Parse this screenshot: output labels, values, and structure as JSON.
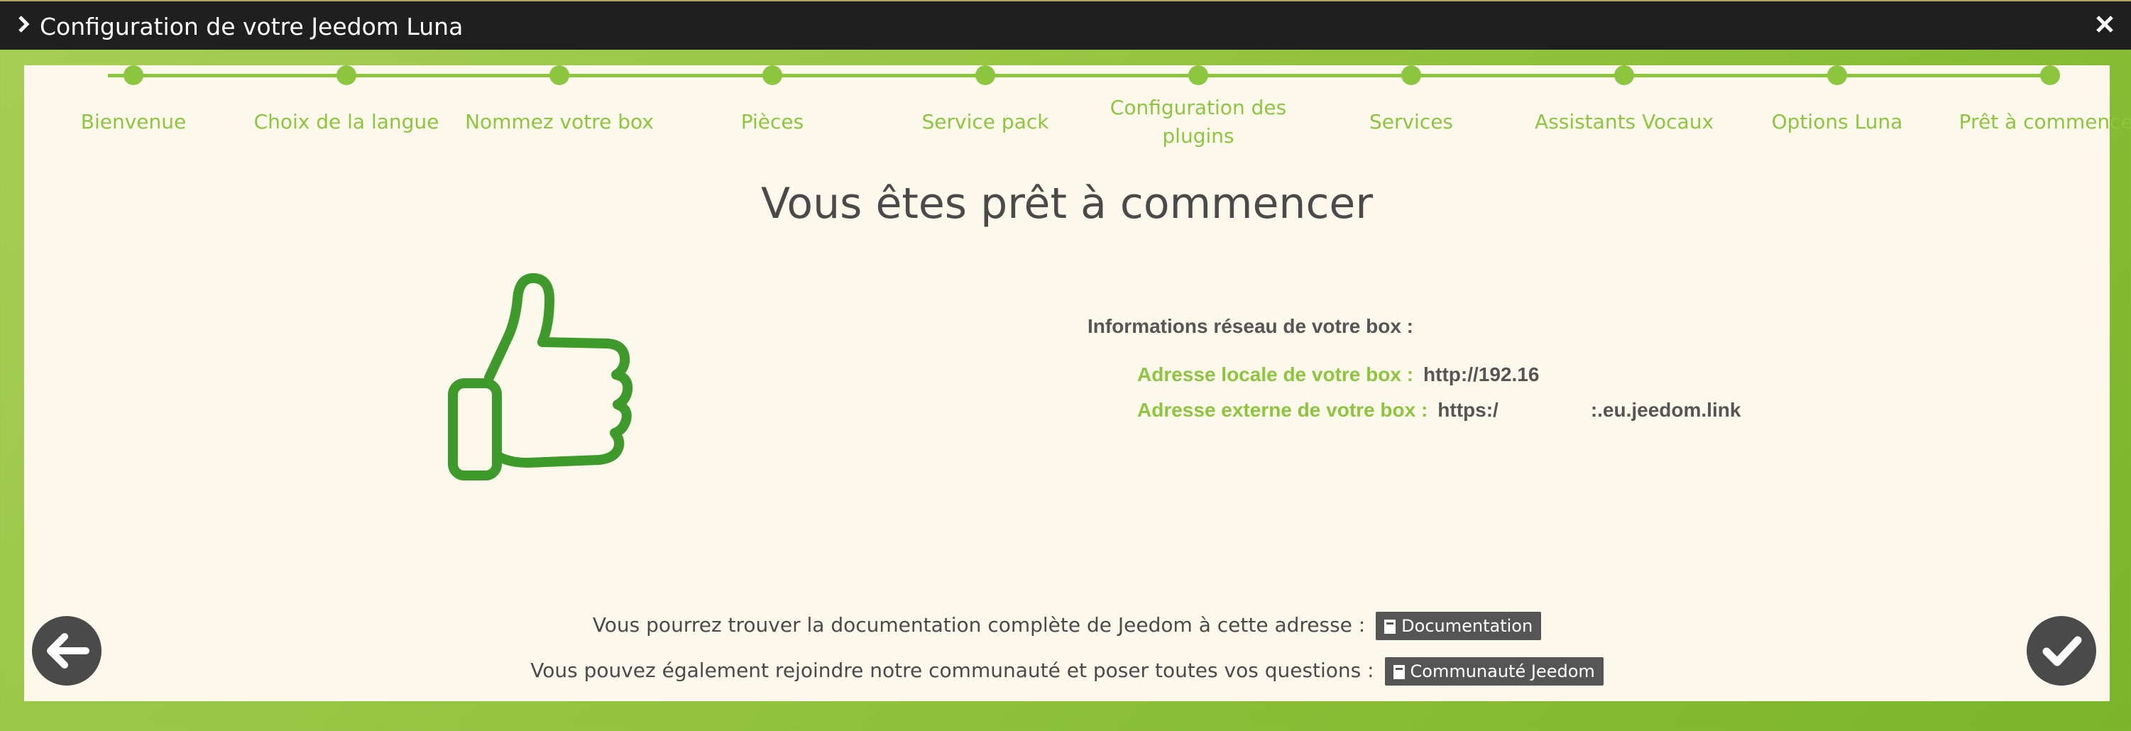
{
  "window": {
    "title": "Configuration de votre Jeedom Luna",
    "title_icon": "chevron-right-icon",
    "close_icon": "close-icon"
  },
  "steps": [
    {
      "label": "Bienvenue"
    },
    {
      "label": "Choix de la langue"
    },
    {
      "label": "Nommez votre box"
    },
    {
      "label": "Pièces"
    },
    {
      "label": "Service pack"
    },
    {
      "label": "Configuration des plugins"
    },
    {
      "label": "Services"
    },
    {
      "label": "Assistants Vocaux"
    },
    {
      "label": "Options Luna"
    },
    {
      "label": "Prêt à commencer"
    }
  ],
  "main": {
    "heading": "Vous êtes prêt à commencer",
    "network_title": "Informations réseau de votre box :",
    "local_label": "Adresse locale de votre box :",
    "local_value": "http://192.16",
    "external_label": "Adresse externe de votre box :",
    "external_value_start": "https:/",
    "external_value_end": ":.eu.jeedom.link"
  },
  "footer": {
    "doc_text": "Vous pourrez trouver la documentation complète de Jeedom à cette adresse :",
    "doc_button": "Documentation",
    "community_text": "Vous pouvez également rejoindre notre communauté et poser toutes vos questions :",
    "community_button": "Communauté Jeedom"
  },
  "colors": {
    "accent": "#8cc63f",
    "thumb": "#3e9a2b",
    "titlebar": "#1f1f1f",
    "panel": "#fdf8ec"
  }
}
